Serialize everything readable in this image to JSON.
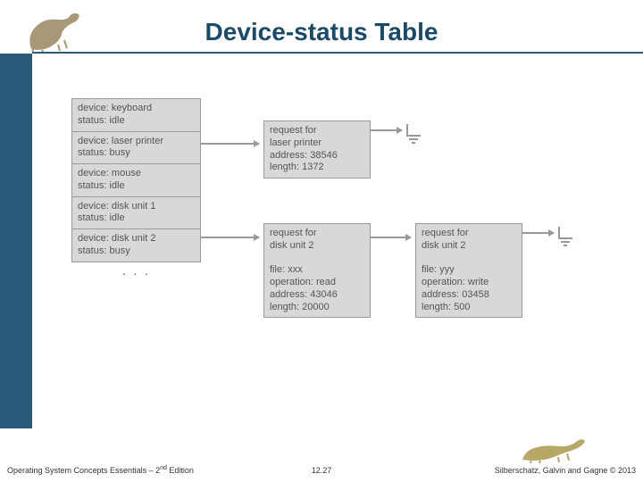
{
  "header": {
    "title": "Device-status Table"
  },
  "devices": [
    {
      "device": "keyboard",
      "status": "idle"
    },
    {
      "device": "laser printer",
      "status": "busy"
    },
    {
      "device": "mouse",
      "status": "idle"
    },
    {
      "device": "disk unit 1",
      "status": "idle"
    },
    {
      "device": "disk unit 2",
      "status": "busy"
    }
  ],
  "requests": {
    "printer": {
      "target": "laser printer",
      "address": "38546",
      "length": "1372"
    },
    "disk1": {
      "target": "disk unit 2",
      "file": "xxx",
      "operation": "read",
      "address": "43046",
      "length": "20000"
    },
    "disk2": {
      "target": "disk unit 2",
      "file": "yyy",
      "operation": "write",
      "address": "03458",
      "length": "500"
    }
  },
  "labels": {
    "device": "device:",
    "status": "status:",
    "request_for": "request for",
    "address": "address:",
    "length": "length:",
    "file": "file:",
    "operation": "operation:"
  },
  "footer": {
    "left_prefix": "Operating System Concepts Essentials – 2",
    "left_suffix": " Edition",
    "left_sup": "nd",
    "center": "12.27",
    "right": "Silberschatz, Galvin and Gagne © 2013"
  }
}
